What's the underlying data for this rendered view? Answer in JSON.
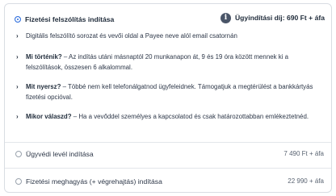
{
  "options": [
    {
      "title": "Fizetési felszólítás indítása",
      "selected": true,
      "fee_label": "Ügyindítási díj: 690 Ft + áfa",
      "info_icon": "i",
      "details": [
        {
          "lead": "",
          "text": "Digitális felszólító sorozat és vevői oldal a Payee neve alól email csatornán"
        },
        {
          "lead": "Mi történik?",
          "text": " – Az indítás utáni másnaptól 20 munkanapon át, 9 és 19 óra között mennek ki a felszólítások, összesen 6 alkalommal."
        },
        {
          "lead": "Mit nyersz?",
          "text": " – Többé nem kell telefonálgatnod ügyfeleidnek. Támogatjuk a megtérülést a bankkártyás fizetési opcióval."
        },
        {
          "lead": "Mikor válaszd?",
          "text": " – Ha a vevőddel személyes a kapcsolatod és csak határozottabban emlékeztetnéd."
        }
      ]
    },
    {
      "title": "Ügyvédi levél indítása",
      "selected": false,
      "price": "7 490 Ft + áfa"
    },
    {
      "title": "Fizetési meghagyás (+ végrehajtás) indítása",
      "selected": false,
      "price": "22 990 + áfa"
    }
  ],
  "chevron": "›",
  "colors": {
    "accent": "#2f6fde",
    "text": "#2d3748",
    "border": "#d9dde3"
  }
}
